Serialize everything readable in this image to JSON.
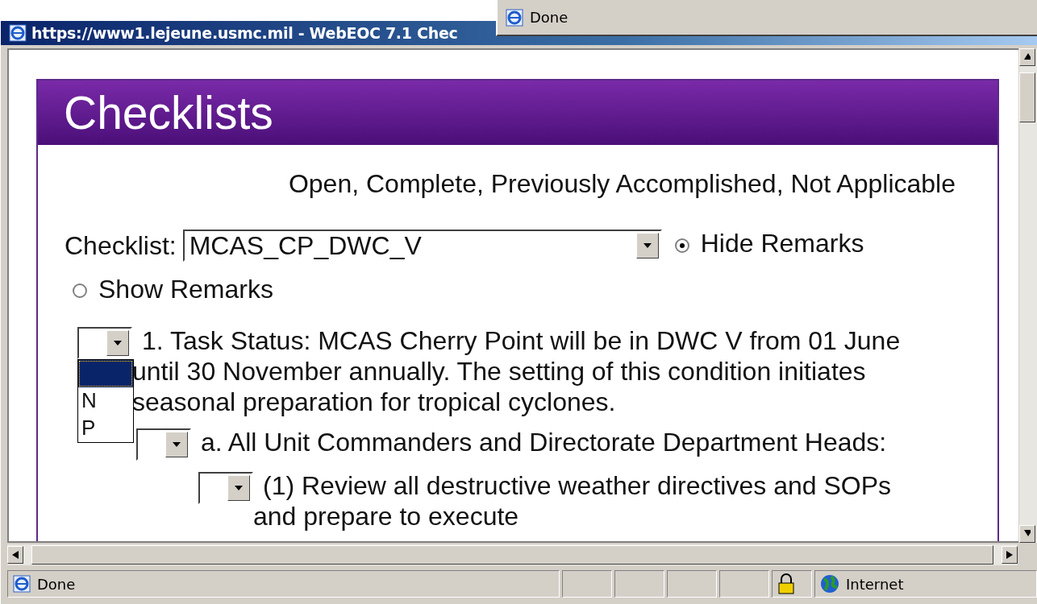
{
  "window": {
    "title": "https://www1.lejeune.usmc.mil - WebEOC 7.1  Chec"
  },
  "background_window": {
    "status": "Done"
  },
  "page": {
    "heading": "Checklists",
    "legend": "Open, Complete, Previously Accomplished, Not Applicable",
    "checklist_label": "Checklist:",
    "checklist_value": "MCAS_CP_DWC_V",
    "remarks_options": [
      {
        "label": "Hide Remarks",
        "selected": true
      },
      {
        "label": "Show Remarks",
        "selected": false
      }
    ],
    "tasks": [
      {
        "text": "1. Task Status: MCAS Cherry Point will be in DWC V from 01 June until 30 November annually. The setting of this condition initiates seasonal preparation for tropical cyclones.",
        "open_list": {
          "blank_highlighted": true,
          "options": [
            "N",
            "P"
          ]
        },
        "children": [
          {
            "text": "a. All Unit Commanders and Directorate Department Heads:",
            "children": [
              {
                "text": "(1) Review all destructive weather directives and SOPs and prepare to execute"
              }
            ]
          }
        ]
      }
    ]
  },
  "status_bar": {
    "text": "Done",
    "secure": true,
    "zone": "Internet"
  }
}
